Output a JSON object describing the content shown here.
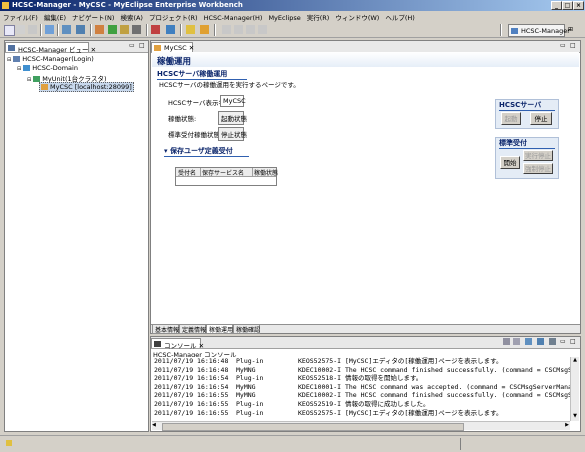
{
  "window": {
    "title": "HCSC-Manager - MyCSC - MyEclipse Enterprise Workbench"
  },
  "menu": [
    "ファイル(F)",
    "編集(E)",
    "ナビゲート(N)",
    "検索(A)",
    "プロジェクト(R)",
    "HCSC-Manager(H)",
    "MyEclipse",
    "実行(R)",
    "ウィンドウ(W)",
    "ヘルプ(H)"
  ],
  "perspective": {
    "label": "HCSC-Manager"
  },
  "left_view": {
    "tab": "HCSC-Manager ビュー",
    "tree": [
      "HCSC-Manager(Login)",
      "HCSC-Domain",
      "MyUnit(1台クラスタ)",
      "MyCSC [localhost:28099]"
    ]
  },
  "editor": {
    "tab": "MyCSC",
    "page_title": "稼働運用",
    "section_title": "HCSCサーバ稼働運用",
    "description": "HCSCサーバの稼働運用を実行するページです。",
    "fields": {
      "server_name_label": "HCSCサーバ表示名:",
      "server_name_value": "MyCSC",
      "status_label": "稼働状態:",
      "status_value": "起動状態",
      "accept_label": "標準受付稼働状態:",
      "accept_value": "停止状態"
    },
    "side": {
      "server_title": "HCSCサーバ",
      "start_btn": "起動",
      "stop_btn": "停止",
      "accept_title": "標準受付",
      "accept_start_btn": "開始",
      "accept_stop_btn": "実行停止",
      "forced_stop_btn": "強制停止"
    },
    "user_def": {
      "title": "▾ 保存ユーザ定義受付",
      "columns": [
        "受付名",
        "保存サービス名",
        "稼働状態"
      ]
    },
    "bottom_tabs": [
      "基本情報",
      "定義情報",
      "稼働運用",
      "稼働確認"
    ]
  },
  "console": {
    "tab": "コンソール",
    "subtitle": "HCSC-Manager コンソール",
    "lines": [
      {
        "ts": "2011/07/19 16:16:48",
        "src": "Plug-in",
        "msg": "KEOS52575-I [MyCSC]エディタの[稼働運用]ページを表示します。"
      },
      {
        "ts": "2011/07/19 16:16:48",
        "src": "MyMNG",
        "msg": "KDEC10002-I The HCSC command finished successfully. (command = CSCMsgS"
      },
      {
        "ts": "2011/07/19 16:16:54",
        "src": "Plug-in",
        "msg": "KEOS52518-I 情報の取得を開始します。"
      },
      {
        "ts": "2011/07/19 16:16:54",
        "src": "MyMNG",
        "msg": "KDEC10001-I The HCSC command was accepted. (command = CSCMsgServerMana"
      },
      {
        "ts": "2011/07/19 16:16:55",
        "src": "MyMNG",
        "msg": "KDEC10002-I The HCSC command finished successfully. (command = CSCMsgS"
      },
      {
        "ts": "2011/07/19 16:16:55",
        "src": "Plug-in",
        "msg": "KEOS52519-I 情報の取得に成功しました。"
      },
      {
        "ts": "2011/07/19 16:16:55",
        "src": "Plug-in",
        "msg": "KEOS52575-I [MyCSC]エディタの[稼働運用]ページを表示します。"
      }
    ]
  }
}
